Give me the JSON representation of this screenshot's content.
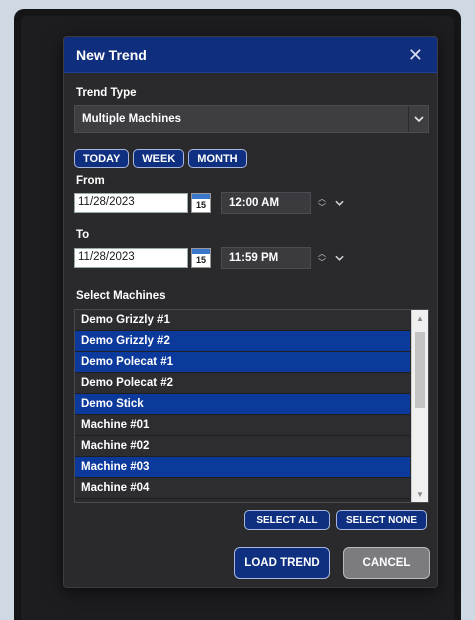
{
  "dialog": {
    "title": "New Trend",
    "close_icon": "close-icon"
  },
  "trend_type": {
    "label": "Trend Type",
    "value": "Multiple Machines"
  },
  "range_buttons": [
    "TODAY",
    "WEEK",
    "MONTH"
  ],
  "from": {
    "label": "From",
    "date": "11/28/2023",
    "calendar_day": "15",
    "time": "12:00 AM"
  },
  "to": {
    "label": "To",
    "date": "11/28/2023",
    "calendar_day": "15",
    "time": "11:59 PM"
  },
  "machines": {
    "label": "Select Machines",
    "items": [
      {
        "name": "Demo Grizzly #1",
        "selected": false
      },
      {
        "name": "Demo Grizzly #2",
        "selected": true
      },
      {
        "name": "Demo Polecat #1",
        "selected": true
      },
      {
        "name": "Demo Polecat #2",
        "selected": false
      },
      {
        "name": "Demo Stick",
        "selected": true
      },
      {
        "name": "Machine #01",
        "selected": false
      },
      {
        "name": "Machine #02",
        "selected": false
      },
      {
        "name": "Machine #03",
        "selected": true
      },
      {
        "name": "Machine #04",
        "selected": false
      }
    ],
    "select_all": "SELECT ALL",
    "select_none": "SELECT NONE"
  },
  "actions": {
    "load": "LOAD TREND",
    "cancel": "CANCEL"
  },
  "colors": {
    "title_bar": "#0f2f7e",
    "selected_row": "#0c3a9c",
    "dialog_bg": "#2a2a2d",
    "accent_border": "#a9b7dd"
  }
}
